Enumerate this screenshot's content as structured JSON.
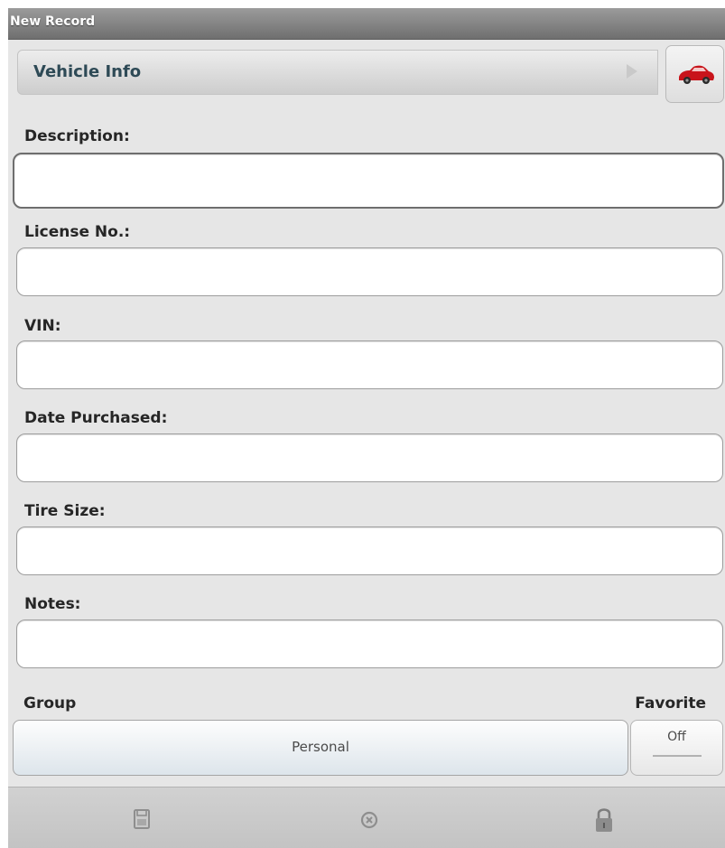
{
  "titlebar": {
    "title": "New Record"
  },
  "category": {
    "label": "Vehicle Info",
    "icon": "car-icon"
  },
  "fields": {
    "description": {
      "label": "Description:",
      "value": ""
    },
    "license": {
      "label": "License No.:",
      "value": ""
    },
    "vin": {
      "label": "VIN:",
      "value": ""
    },
    "date_purchased": {
      "label": "Date Purchased:",
      "value": ""
    },
    "tire_size": {
      "label": "Tire Size:",
      "value": ""
    },
    "notes": {
      "label": "Notes:",
      "value": ""
    }
  },
  "group": {
    "label": "Group",
    "value": "Personal"
  },
  "favorite": {
    "label": "Favorite",
    "value": "Off"
  },
  "toolbar": {
    "buttons": [
      {
        "icon": "save-icon"
      },
      {
        "icon": "cancel-icon"
      },
      {
        "icon": "lock-icon"
      }
    ]
  },
  "colors": {
    "titlebar": "#7f7f7f",
    "category_text": "#2e4a56",
    "car": "#c8141b"
  }
}
